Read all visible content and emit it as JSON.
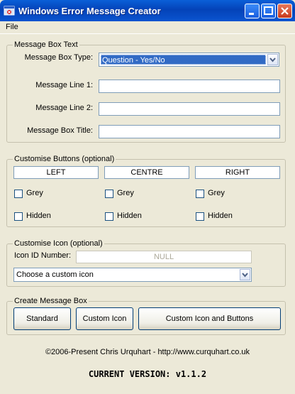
{
  "window": {
    "title": "Windows Error Message Creator",
    "icon": "error-app-icon"
  },
  "menu": {
    "file": "File"
  },
  "message_box_text": {
    "legend": "Message Box Text",
    "type_label": "Message Box Type:",
    "type_value": "Question - Yes/No",
    "line1_label": "Message Line 1:",
    "line1_value": "",
    "line2_label": "Message Line 2:",
    "line2_value": "",
    "title_label": "Message Box Title:",
    "title_value": ""
  },
  "customise_buttons": {
    "legend": "Customise Buttons (optional)",
    "buttons": [
      {
        "value": "LEFT",
        "grey_label": "Grey",
        "hidden_label": "Hidden",
        "grey": false,
        "hidden": false
      },
      {
        "value": "CENTRE",
        "grey_label": "Grey",
        "hidden_label": "Hidden",
        "grey": false,
        "hidden": false
      },
      {
        "value": "RIGHT",
        "grey_label": "Grey",
        "hidden_label": "Hidden",
        "grey": false,
        "hidden": false
      }
    ]
  },
  "customise_icon": {
    "legend": "Customise Icon (optional)",
    "id_label": "Icon ID Number:",
    "id_value": "NULL",
    "select_value": "Choose a custom icon"
  },
  "create": {
    "legend": "Create Message Box",
    "standard": "Standard",
    "custom_icon": "Custom Icon",
    "custom_icon_buttons": "Custom Icon and Buttons"
  },
  "footer": {
    "copyright": "©2006-Present Chris Urquhart - http://www.curquhart.co.uk",
    "version": "CURRENT VERSION: v1.1.2"
  },
  "colors": {
    "titlebar": "#0a54d0",
    "selection": "#316ac5",
    "face": "#ece9d8"
  }
}
